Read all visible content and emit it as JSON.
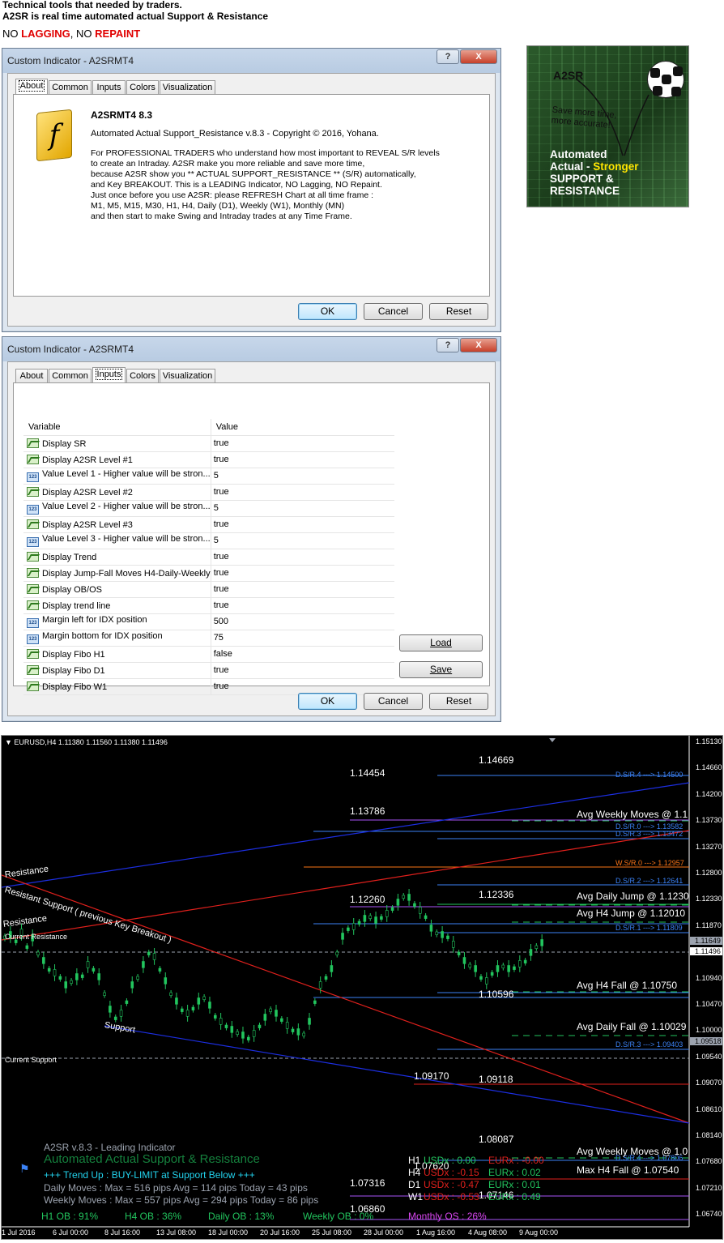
{
  "header": {
    "line1": "Technical tools that needed by traders.",
    "line2": "A2SR is real time automated actual Support & Resistance",
    "line3_a": "NO ",
    "line3_b": "LAGGING",
    "line3_c": ", NO ",
    "line3_d": "REPAINT"
  },
  "dialog1": {
    "title": "Custom Indicator - A2SRMT4",
    "help": "?",
    "close": "X",
    "tabs": [
      "About",
      "Common",
      "Inputs",
      "Colors",
      "Visualization"
    ],
    "active_tab": "About",
    "product_title": "A2SRMT4 8.3",
    "copyright": "Automated Actual Support_Resistance v.8.3 - Copyright © 2016, Yohana.",
    "description": "For PROFESSIONAL TRADERS who understand how most important to REVEAL S/R levels\nto create an Intraday. A2SR make you more reliable and save more time,\nbecause A2SR show you ** ACTUAL SUPPORT_RESISTANCE ** (S/R) automatically,\nand Key BREAKOUT. This is a LEADING Indicator, NO Lagging, NO Repaint.\nJust once before you use A2SR: please REFRESH Chart at all time frame :\nM1, M5, M15, M30, H1, H4, Daily (D1), Weekly (W1), Monthly (MN)\nand then start to make Swing and Intraday trades at any Time Frame.",
    "ok": "OK",
    "cancel": "Cancel",
    "reset": "Reset",
    "icon": "function-f-icon"
  },
  "promo": {
    "brand": "A2SR",
    "tagline": "Save more time,\nmore accurate!",
    "line_a": "Automated",
    "line_b": "Actual - ",
    "line_b_hl": "Stronger",
    "line_c": "SUPPORT &\nRESISTANCE"
  },
  "dialog2": {
    "title": "Custom Indicator - A2SRMT4",
    "tabs": [
      "About",
      "Common",
      "Inputs",
      "Colors",
      "Visualization"
    ],
    "active_tab": "Inputs",
    "col_variable": "Variable",
    "col_value": "Value",
    "rows": [
      {
        "icon": "graph",
        "name": "Display SR",
        "value": "true"
      },
      {
        "icon": "graph",
        "name": "Display A2SR Level #1",
        "value": "true"
      },
      {
        "icon": "123",
        "name": "Value Level 1 - Higher value will be stron...",
        "value": "5"
      },
      {
        "icon": "graph",
        "name": "Display A2SR Level #2",
        "value": "true"
      },
      {
        "icon": "123",
        "name": "Value Level 2 - Higher value will be stron...",
        "value": "5"
      },
      {
        "icon": "graph",
        "name": "Display A2SR Level #3",
        "value": "true"
      },
      {
        "icon": "123",
        "name": "Value Level 3 - Higher value will be stron...",
        "value": "5"
      },
      {
        "icon": "graph",
        "name": "Display Trend",
        "value": "true"
      },
      {
        "icon": "graph",
        "name": "Display Jump-Fall Moves H4-Daily-Weekly",
        "value": "true"
      },
      {
        "icon": "graph",
        "name": "Display OB/OS",
        "value": "true"
      },
      {
        "icon": "graph",
        "name": "Display trend line",
        "value": "true"
      },
      {
        "icon": "123",
        "name": "Margin left for IDX position",
        "value": "500"
      },
      {
        "icon": "123",
        "name": "Margin bottom for IDX position",
        "value": "75"
      },
      {
        "icon": "graph",
        "name": "Display Fibo H1",
        "value": "false"
      },
      {
        "icon": "graph",
        "name": "Display Fibo D1",
        "value": "true"
      },
      {
        "icon": "graph",
        "name": "Display Fibo W1",
        "value": "true"
      }
    ],
    "load": "Load",
    "save": "Save",
    "ok": "OK",
    "cancel": "Cancel",
    "reset": "Reset"
  },
  "chart": {
    "symbol_line": "EURUSD,H4  1.11380 1.11560 1.11380 1.11496",
    "price_axis": [
      "1.15130",
      "1.14660",
      "1.14200",
      "1.13730",
      "1.13270",
      "1.12800",
      "1.12330",
      "1.11870",
      "1.11400",
      "1.10940",
      "1.10470",
      "1.10000",
      "1.09540",
      "1.09070",
      "1.08610",
      "1.08140",
      "1.07680",
      "1.07210",
      "1.06740"
    ],
    "current_price": "1.11496",
    "mark_price_1": "1.11649",
    "mark_price_2": "1.09518",
    "time_axis": [
      "1 Jul 2016",
      "6 Jul 00:00",
      "8 Jul 16:00",
      "13 Jul 08:00",
      "18 Jul 00:00",
      "20 Jul 16:00",
      "25 Jul 08:00",
      "28 Jul 00:00",
      "1 Aug 16:00",
      "4 Aug 08:00",
      "9 Aug 00:00"
    ],
    "levels": {
      "l1": "1.14669",
      "l2": "1.14454",
      "l3": "1.13786",
      "l4": "1.12260",
      "l5": "1.12336",
      "l6": "1.10596",
      "l7": "1.09170",
      "l8": "1.09118",
      "l9": "1.08087",
      "l10": "1.07316",
      "l11": "1.07620",
      "l12": "1.07146",
      "l13": "1.06860"
    },
    "sr_labels": {
      "sr4": "D.S/R.4 ---> 1.14500",
      "sr0": "D.S/R.0 ---> 1.13582",
      "sr3": "D.S/R.3 ---> 1.13472",
      "ws0": "W.S/R.0 ---> 1.12957",
      "sr2": "D.S/R.2 ---> 1.12641",
      "sr1": "D.S/R.1 ---> 1.11809",
      "sr3b": "D.S/R.3 ---> 1.09403",
      "sr4b": "D.S/R.4 ---> 1.07806"
    },
    "moves": {
      "avg_weekly": "Avg Weekly Moves @ 1.1",
      "avg_daily_jump": "Avg Daily Jump @ 1.1230",
      "avg_h4_jump": "Avg H4 Jump @ 1.12010",
      "avg_h4_fall": "Avg H4 Fall @ 1.10750",
      "avg_daily_fall": "Avg Daily Fall @ 1.10029",
      "avg_weekly_b": "Avg Weekly Moves @ 1.0",
      "max_h4_fall": "Max H4 Fall @ 1.07540"
    },
    "annot": {
      "current_resistance": "Current Resistance",
      "current_support": "Current Support",
      "resistance": "Resistance",
      "support": "Support",
      "resist_support": "Resistant Support ( previous Key Breakout )",
      "resistance_top": "Resistance"
    },
    "info": {
      "line1": "A2SR v.8.3 - Leading Indicator",
      "line2": "Automated Actual Support & Resistance",
      "line3": "+++  Trend Up : BUY-LIMIT at Support Below +++",
      "line4": "Daily Moves     : Max = 516 pips Avg = 114 pips Today = 43 pips",
      "line5": "Weekly Moves : Max = 557 pips Avg = 294 pips Today = 86 pips",
      "h1ob": "H1 OB : 91%",
      "h4ob": "H4 OB : 36%",
      "dailyob": "Daily OB : 13%",
      "weeklyob": "Weekly OB : 0%",
      "monthlyos": "Monthly OS : 26%"
    },
    "idx": [
      {
        "tf": "H1",
        "usd": "USDx : 0.00",
        "eur": "EURx : -0.00"
      },
      {
        "tf": "H4",
        "usd": "USDx : -0.15",
        "eur": "EURx : 0.02"
      },
      {
        "tf": "D1",
        "usd": "USDx : -0.47",
        "eur": "EURx : 0.01"
      },
      {
        "tf": "W1",
        "usd": "USDx : -0.53",
        "eur": "EURx : 0.49"
      }
    ],
    "colors": {
      "bg": "#000000",
      "candle": "#22c55e",
      "resistance_line": "#e0201c",
      "support_line": "#1c2ee0",
      "sr_label": "#3b82f6",
      "level_label": "#ffffff"
    }
  }
}
